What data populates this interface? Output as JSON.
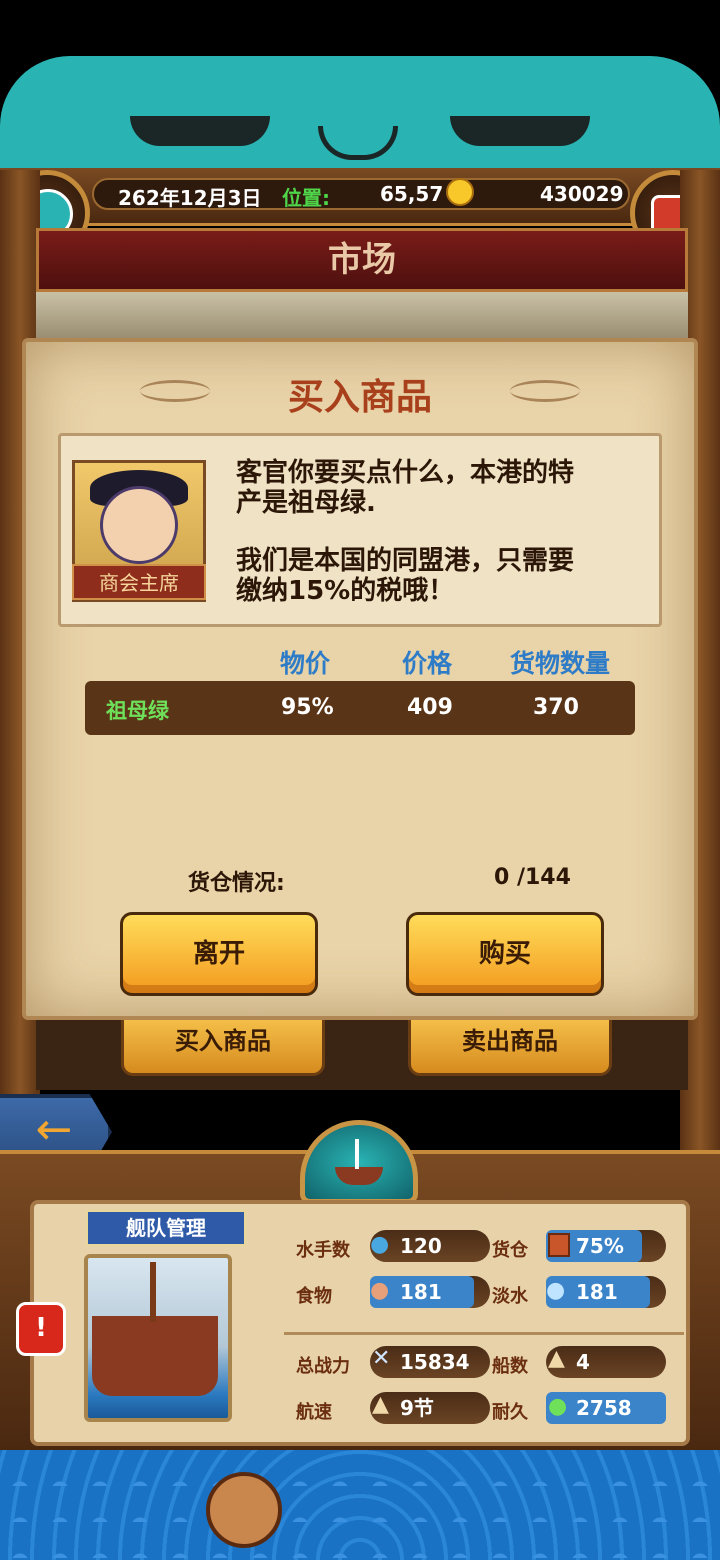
{
  "hud": {
    "date": "262年12月3日",
    "position_label": "位置:",
    "position_value": "65,57",
    "gold": "430029"
  },
  "market_title": "市场",
  "dialog": {
    "title": "买入商品",
    "speaker": "商会主席",
    "line1a": "客官你要买点什么，本港的特",
    "line1b": "产是祖母绿.",
    "line2a": "我们是本国的同盟港，只需要",
    "line2b": "缴纳15%的税哦！"
  },
  "table": {
    "headers": [
      "物价",
      "价格",
      "货物数量"
    ],
    "row": {
      "name": "祖母绿",
      "price_index": "95%",
      "price": "409",
      "quantity": "370"
    }
  },
  "hold": {
    "label": "货仓情况:",
    "value": "0 /144"
  },
  "buttons": {
    "leave": "离开",
    "buy": "购买"
  },
  "tabs": {
    "buy": "买入商品",
    "sell": "卖出商品"
  },
  "fleet": {
    "title": "舰队管理",
    "alert": "!",
    "stats": {
      "sailors_label": "水手数",
      "sailors": "120",
      "cargo_label": "货仓",
      "cargo": "75%",
      "food_label": "食物",
      "food": "181",
      "water_label": "淡水",
      "water": "181",
      "power_label": "总战力",
      "power": "15834",
      "ships_label": "船数",
      "ships": "4",
      "speed_label": "航速",
      "speed": "9节",
      "durability_label": "耐久",
      "durability": "2758"
    }
  },
  "colors": {
    "accent_blue": "#2e7cc8",
    "title_red": "#a8401c",
    "green_item": "#6fe05a",
    "button_orange": "#f39a1e"
  },
  "icons": [
    "player-avatar-icon",
    "coin-icon",
    "treasure-chest-icon",
    "back-arrow-icon",
    "boat-icon",
    "sailor-icon",
    "crate-icon",
    "meat-icon",
    "water-jug-icon",
    "crossed-swords-icon",
    "sail-icon",
    "speed-icon",
    "durability-icon"
  ]
}
